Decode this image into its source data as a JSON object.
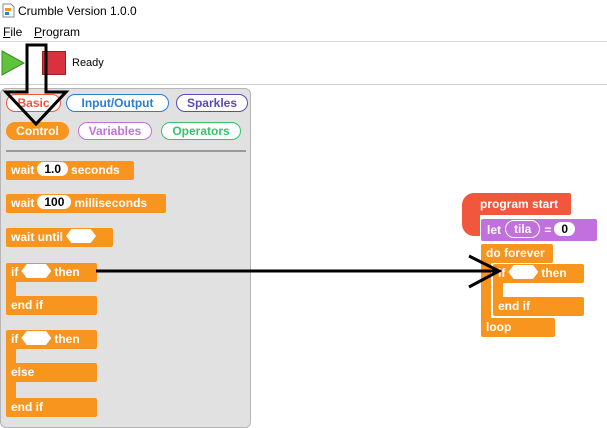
{
  "window": {
    "title": "Crumble Version 1.0.0"
  },
  "menu": {
    "file": "File",
    "program": "Program"
  },
  "toolbar": {
    "status": "Ready"
  },
  "categories": {
    "basic": "Basic",
    "io": "Input/Output",
    "sparkles": "Sparkles",
    "control": "Control",
    "variables": "Variables",
    "operators": "Operators"
  },
  "palette": {
    "wait": "wait",
    "wait_value": "1.0",
    "seconds": "seconds",
    "wait_ms": "wait",
    "ms_value": "100",
    "milliseconds": "milliseconds",
    "wait_until": "wait until",
    "if1": "if",
    "then1": "then",
    "endif1": "end if",
    "if2": "if",
    "then2": "then",
    "else2": "else",
    "endif2": "end if"
  },
  "script": {
    "program_start": "program start",
    "let": "let",
    "var": "tila",
    "equals": "=",
    "let_value": "0",
    "do_forever": "do forever",
    "if": "if",
    "then": "then",
    "end_if": "end if",
    "loop": "loop"
  },
  "colors": {
    "control": "#f7951f",
    "start": "#f0573c",
    "variable": "#c270de",
    "basic": "#f0573c",
    "io": "#2d7cd6",
    "sparkles": "#5a4bb5",
    "variables_cat": "#c270de",
    "operators_cat": "#35c46a"
  }
}
